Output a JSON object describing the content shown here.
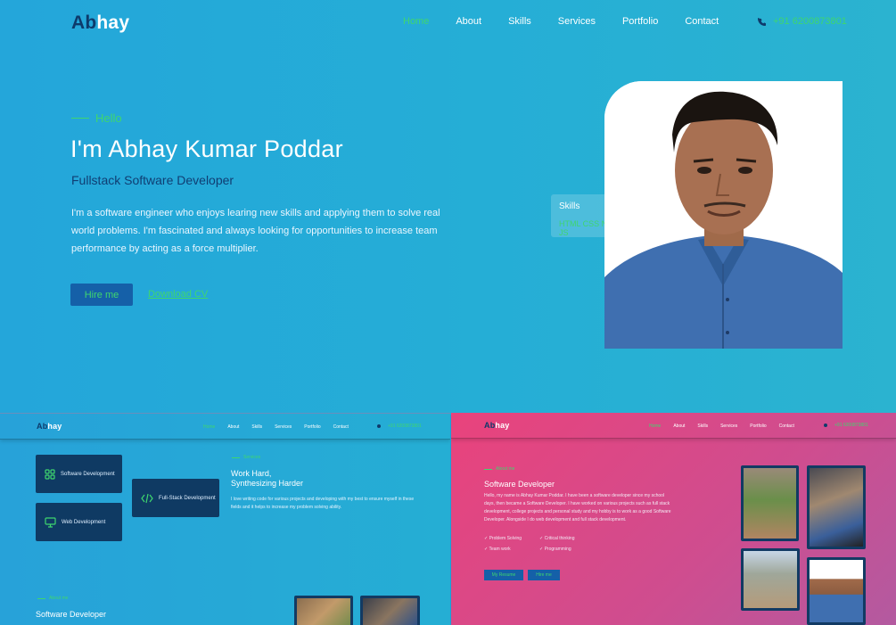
{
  "header": {
    "logo_a": "Ab",
    "logo_b": "hay",
    "nav": [
      "Home",
      "About",
      "Skills",
      "Services",
      "Portfolio",
      "Contact"
    ],
    "phone": "+91 6200873801"
  },
  "hero": {
    "greeting": "Hello",
    "title": "I'm Abhay Kumar Poddar",
    "role": "Fullstack Software Developer",
    "description": "I'm a software engineer who enjoys learing new skills and applying them to solve real world problems. I'm fascinated and always looking for opportunities to increase team performance by acting as a force multiplier.",
    "hire_label": "Hire me",
    "download_label": "Download CV",
    "skills_card_title": "Skills",
    "skills_card_sub": "HTML CSS Node JS"
  },
  "preview_services": {
    "nav": [
      "Home",
      "About",
      "Skills",
      "Services",
      "Portfolio",
      "Contact"
    ],
    "phone": "+91 6200873801",
    "cards": [
      "Software Development",
      "Full-Stack Development",
      "Web Development"
    ],
    "eyebrow": "Services",
    "heading_1": "Work Hard,",
    "heading_2": "Synthesizing Harder",
    "text": "I love writing code for various projects and developing with my best to ensure myself in these fields and it helps to increase my problem solving ability.",
    "bottom_eyebrow": "About me",
    "bottom_title": "Software Developer"
  },
  "preview_about": {
    "nav": [
      "Home",
      "About",
      "Skills",
      "Services",
      "Portfolio",
      "Contact"
    ],
    "phone": "+91 6200873801",
    "eyebrow": "About me",
    "title": "Software Developer",
    "text": "Hello, my name is Abhay Kumar Poddar. I have been a software developer since my school days, then became a Software Developer. I have worked on various projects such as full stack development, college projects and personal study and my hobby is to work as a good Software Developer. Alongside I do web development and full stack development.",
    "features": [
      "Problem Solving",
      "Critical thinking",
      "Team work",
      "Programming"
    ],
    "button_1": "My Resume",
    "button_2": "Hire me"
  }
}
